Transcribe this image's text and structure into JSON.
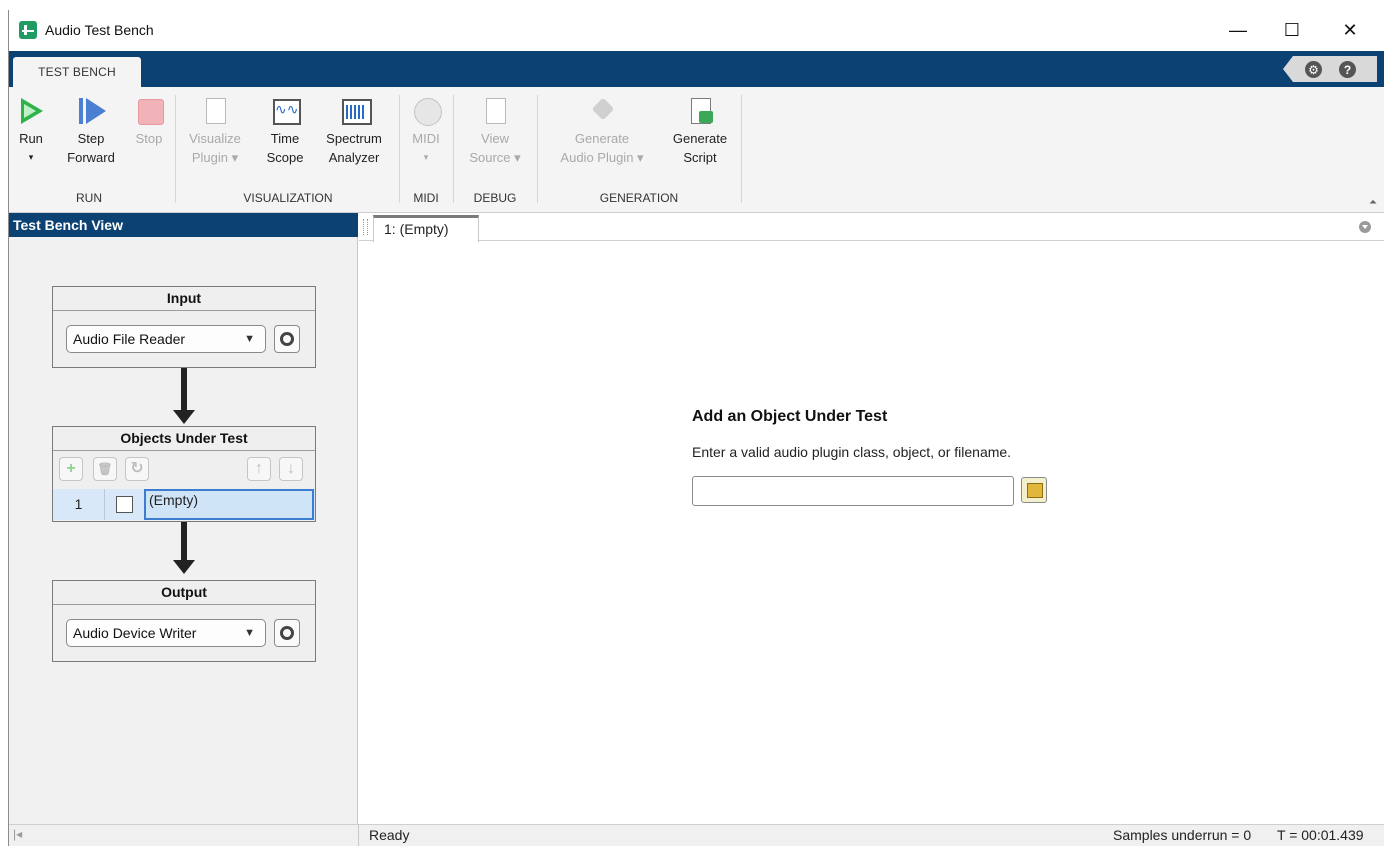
{
  "window": {
    "title": "Audio Test Bench",
    "minimize": "—",
    "maximize": "☐",
    "close": "✕"
  },
  "tabs": {
    "active": "TEST BENCH"
  },
  "quick_access": {
    "settings": "⚙",
    "help": "?"
  },
  "ribbon": {
    "run": {
      "tools": [
        "Run",
        "Step",
        "Forward",
        "Stop"
      ],
      "caret": "▾",
      "label": "RUN"
    },
    "visualization": {
      "visualize_line1": "Visualize",
      "visualize_line2": "Plugin ▾",
      "time_line1": "Time",
      "time_line2": "Scope",
      "spectrum_line1": "Spectrum",
      "spectrum_line2": "Analyzer",
      "label": "VISUALIZATION"
    },
    "midi": {
      "tool": "MIDI",
      "caret": "▾",
      "label": "MIDI"
    },
    "debug": {
      "line1": "View",
      "line2": "Source ▾",
      "label": "DEBUG"
    },
    "generation": {
      "gen_plugin_line1": "Generate",
      "gen_plugin_line2": "Audio Plugin ▾",
      "gen_script_line1": "Generate",
      "gen_script_line2": "Script",
      "label": "GENERATION"
    },
    "collapse_icon": "⏶"
  },
  "left_panel": {
    "title": "Test Bench View",
    "input": {
      "title": "Input",
      "selected": "Audio File Reader"
    },
    "objects": {
      "title": "Objects Under Test",
      "toolbar": [
        "+",
        "🗑",
        "↻",
        "↑",
        "↓"
      ],
      "rows": [
        {
          "index": "1",
          "checked": false,
          "name": "(Empty)"
        }
      ]
    },
    "output": {
      "title": "Output",
      "selected": "Audio Device Writer"
    }
  },
  "document": {
    "tab": "1: (Empty)",
    "heading": "Add an Object Under Test",
    "description": "Enter a valid audio plugin class, object, or filename.",
    "input_value": ""
  },
  "status": {
    "collapse": "|◂",
    "ready": "Ready",
    "underrun": "Samples underrun = 0",
    "time": "T = 00:01.439"
  }
}
